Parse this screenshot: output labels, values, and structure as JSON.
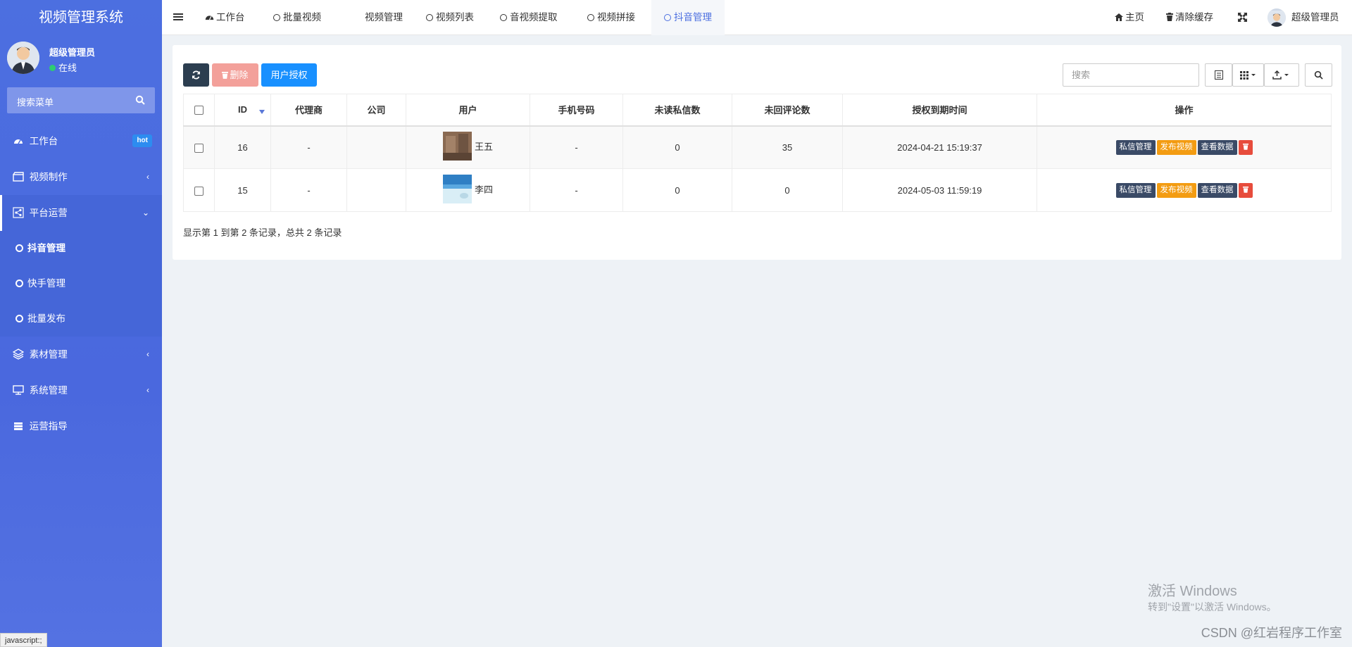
{
  "sidebar": {
    "brand": "视频管理系统",
    "user_name": "超级管理员",
    "user_status": "在线",
    "search_placeholder": "搜索菜单",
    "items": [
      {
        "label": "工作台",
        "badge": "hot",
        "icon": "dashboard-icon"
      },
      {
        "label": "视频制作",
        "icon": "film-icon"
      },
      {
        "label": "平台运营",
        "icon": "share-icon"
      },
      {
        "label": "素材管理",
        "icon": "layers-icon"
      },
      {
        "label": "系统管理",
        "icon": "monitor-icon"
      },
      {
        "label": "运营指导",
        "icon": "server-icon"
      }
    ],
    "sub_items": [
      {
        "label": "抖音管理"
      },
      {
        "label": "快手管理"
      },
      {
        "label": "批量发布"
      }
    ],
    "status_bar": "javascript:;"
  },
  "topbar": {
    "tabs": [
      {
        "label": "工作台"
      },
      {
        "label": "批量视频"
      },
      {
        "label": "视频管理"
      },
      {
        "label": "视频列表"
      },
      {
        "label": "音视频提取"
      },
      {
        "label": "视频拼接"
      },
      {
        "label": "抖音管理"
      }
    ],
    "home_label": "主页",
    "clear_cache_label": "清除缓存",
    "user_name": "超级管理员"
  },
  "toolbar": {
    "delete_label": "删除",
    "auth_label": "用户授权",
    "search_placeholder": "搜索"
  },
  "table": {
    "headers": [
      "ID",
      "代理商",
      "公司",
      "用户",
      "手机号码",
      "未读私信数",
      "未回评论数",
      "授权到期时间",
      "操作"
    ],
    "rows": [
      {
        "id": "16",
        "agent": "-",
        "company": "",
        "user": "王五",
        "phone": "-",
        "unread": "0",
        "unreplied": "35",
        "expire": "2024-04-21 15:19:37"
      },
      {
        "id": "15",
        "agent": "-",
        "company": "",
        "user": "李四",
        "phone": "-",
        "unread": "0",
        "unreplied": "0",
        "expire": "2024-05-03 11:59:19"
      }
    ],
    "actions": {
      "msg": "私信管理",
      "publish": "发布视频",
      "view": "查看数据"
    },
    "summary": "显示第 1 到第 2 条记录，总共 2 条记录"
  },
  "watermark": {
    "line1": "激活 Windows",
    "line2": "转到\"设置\"以激活 Windows。",
    "csdn": "CSDN @红岩程序工作室"
  },
  "colors": {
    "sidebar": "#4c6fe0",
    "primary": "#1890ff",
    "warning": "#f39c12",
    "danger": "#e74c3c",
    "dark": "#2c3e50"
  }
}
